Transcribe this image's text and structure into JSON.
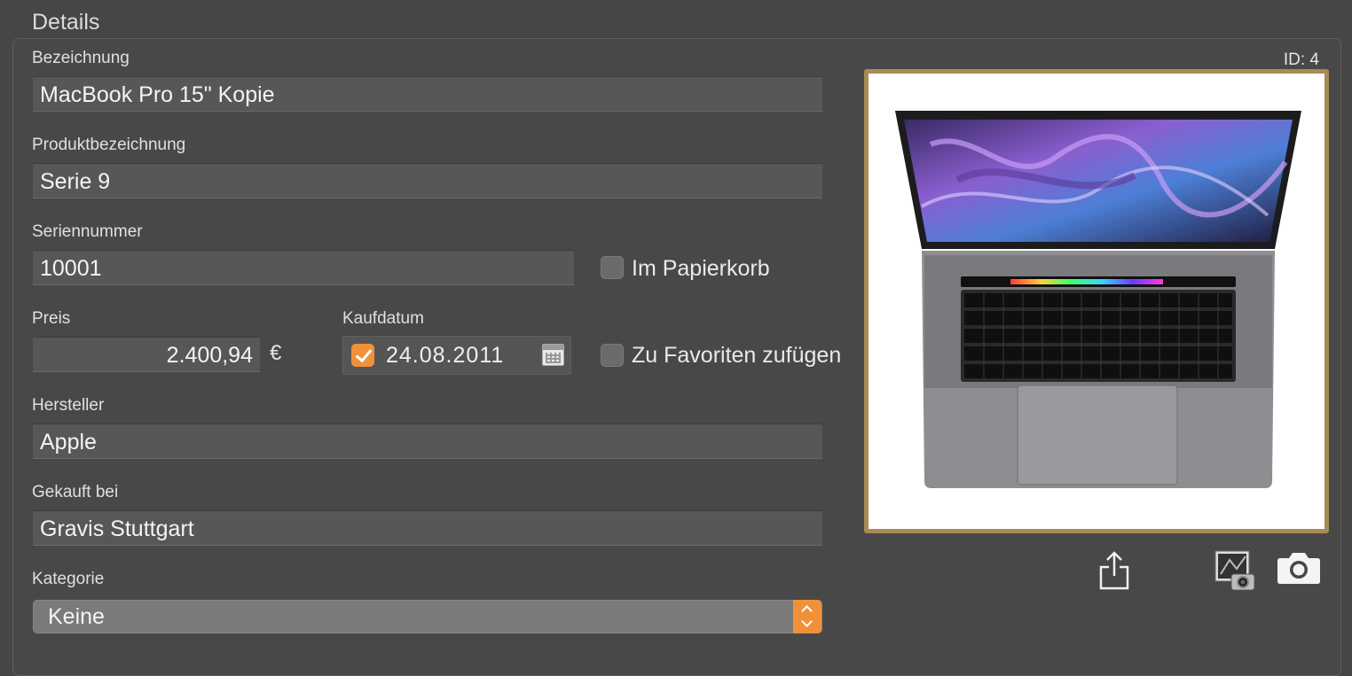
{
  "section": {
    "title": "Details"
  },
  "record": {
    "id_label": "ID: 4"
  },
  "form": {
    "bezeichnung": {
      "label": "Bezeichnung",
      "value": "MacBook Pro 15\" Kopie"
    },
    "produktbezeichnung": {
      "label": "Produktbezeichnung",
      "value": "Serie 9"
    },
    "seriennummer": {
      "label": "Seriennummer",
      "value": "10001"
    },
    "preis": {
      "label": "Preis",
      "value": "2.400,94",
      "currency": "€"
    },
    "kaufdatum": {
      "label": "Kaufdatum",
      "value": "24.08.2011",
      "enabled": true
    },
    "hersteller": {
      "label": "Hersteller",
      "value": "Apple"
    },
    "gekauft_bei": {
      "label": "Gekauft bei",
      "value": "Gravis Stuttgart"
    },
    "kategorie": {
      "label": "Kategorie",
      "value": "Keine"
    },
    "papierkorb": {
      "label": "Im Papierkorb",
      "checked": false
    },
    "favoriten": {
      "label": "Zu Favoriten zufügen",
      "checked": false
    }
  },
  "image": {
    "subject": "macbook-pro-photo",
    "frame_color": "#a88a55"
  },
  "actions": {
    "icons": [
      "share-icon",
      "iphoto-icon",
      "camera-icon"
    ]
  },
  "colors": {
    "accent": "#f0913a",
    "background": "#464646",
    "field": "#575757"
  }
}
